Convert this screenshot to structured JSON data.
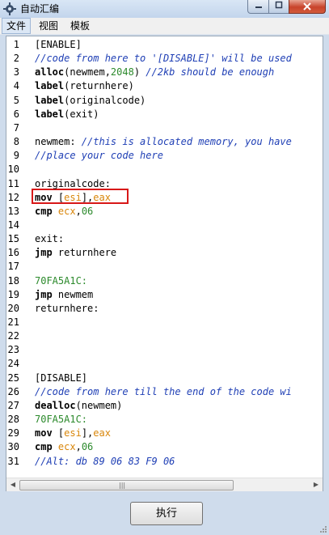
{
  "window": {
    "title": "自动汇编"
  },
  "menu": {
    "file": "文件",
    "view": "视图",
    "template": "模板"
  },
  "editor": {
    "lines": [
      [
        {
          "t": "[ENABLE]",
          "c": "pl"
        }
      ],
      [
        {
          "t": "//code from here to '[DISABLE]' will be used",
          "c": "cm"
        }
      ],
      [
        {
          "t": "alloc",
          "c": "kw"
        },
        {
          "t": "(newmem,",
          "c": "pl"
        },
        {
          "t": "2048",
          "c": "nm"
        },
        {
          "t": ") ",
          "c": "pl"
        },
        {
          "t": "//2kb should be enough",
          "c": "cm"
        }
      ],
      [
        {
          "t": "label",
          "c": "kw"
        },
        {
          "t": "(returnhere)",
          "c": "pl"
        }
      ],
      [
        {
          "t": "label",
          "c": "kw"
        },
        {
          "t": "(originalcode)",
          "c": "pl"
        }
      ],
      [
        {
          "t": "label",
          "c": "kw"
        },
        {
          "t": "(exit)",
          "c": "pl"
        }
      ],
      [],
      [
        {
          "t": "newmem: ",
          "c": "pl"
        },
        {
          "t": "//this is allocated memory, you have",
          "c": "cm"
        }
      ],
      [
        {
          "t": "//place your code here",
          "c": "cm"
        }
      ],
      [],
      [
        {
          "t": "originalcode:",
          "c": "pl"
        }
      ],
      [
        {
          "t": "mov ",
          "c": "kw"
        },
        {
          "t": "[",
          "c": "pl"
        },
        {
          "t": "esi",
          "c": "rg"
        },
        {
          "t": "],",
          "c": "pl"
        },
        {
          "t": "eax",
          "c": "rg"
        }
      ],
      [
        {
          "t": "cmp ",
          "c": "kw"
        },
        {
          "t": "ecx",
          "c": "rg"
        },
        {
          "t": ",",
          "c": "pl"
        },
        {
          "t": "06",
          "c": "nm"
        }
      ],
      [],
      [
        {
          "t": "exit:",
          "c": "pl"
        }
      ],
      [
        {
          "t": "jmp ",
          "c": "kw"
        },
        {
          "t": "returnhere",
          "c": "pl"
        }
      ],
      [],
      [
        {
          "t": "70FA5A1C:",
          "c": "nm"
        }
      ],
      [
        {
          "t": "jmp ",
          "c": "kw"
        },
        {
          "t": "newmem",
          "c": "pl"
        }
      ],
      [
        {
          "t": "returnhere:",
          "c": "pl"
        }
      ],
      [],
      [],
      [],
      [],
      [
        {
          "t": "[DISABLE]",
          "c": "pl"
        }
      ],
      [
        {
          "t": "//code from here till the end of the code wi",
          "c": "cm"
        }
      ],
      [
        {
          "t": "dealloc",
          "c": "kw"
        },
        {
          "t": "(newmem)",
          "c": "pl"
        }
      ],
      [
        {
          "t": "70FA5A1C:",
          "c": "nm"
        }
      ],
      [
        {
          "t": "mov ",
          "c": "kw"
        },
        {
          "t": "[",
          "c": "pl"
        },
        {
          "t": "esi",
          "c": "rg"
        },
        {
          "t": "],",
          "c": "pl"
        },
        {
          "t": "eax",
          "c": "rg"
        }
      ],
      [
        {
          "t": "cmp ",
          "c": "kw"
        },
        {
          "t": "ecx",
          "c": "rg"
        },
        {
          "t": ",",
          "c": "pl"
        },
        {
          "t": "06",
          "c": "nm"
        }
      ],
      [
        {
          "t": "//Alt: db 89 06 83 F9 06",
          "c": "cm"
        }
      ]
    ],
    "highlighted_line": 12
  },
  "footer": {
    "execute_label": "执行"
  },
  "colors": {
    "comment": "#1f3fb5",
    "number": "#2c8a2c",
    "register": "#d9860a",
    "highlight": "#d81818"
  }
}
